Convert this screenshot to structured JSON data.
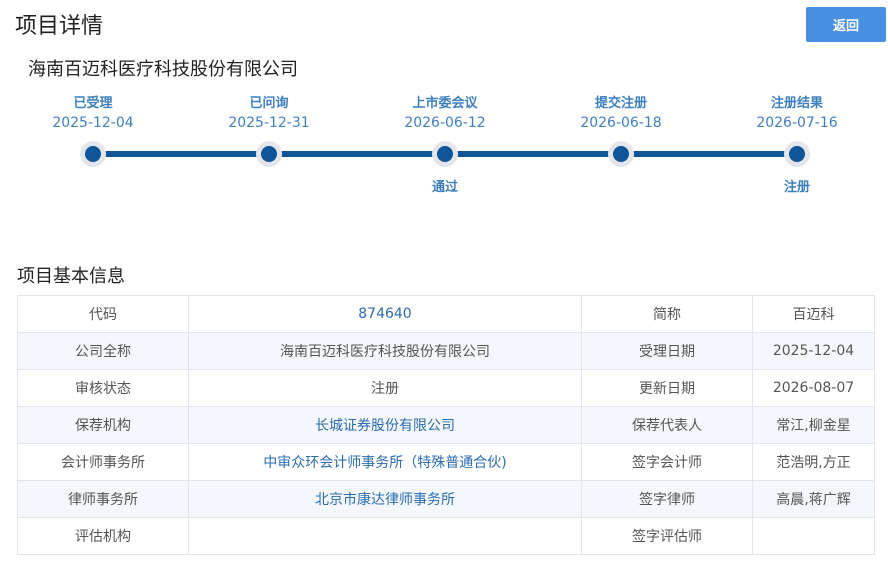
{
  "header": {
    "title": "项目详情",
    "back_label": "返回"
  },
  "company_name": "海南百迈科医疗科技股份有限公司",
  "timeline": {
    "steps": [
      {
        "label": "已受理",
        "date": "2025-12-04",
        "result": ""
      },
      {
        "label": "已问询",
        "date": "2025-12-31",
        "result": ""
      },
      {
        "label": "上市委会议",
        "date": "2026-06-12",
        "result": "通过"
      },
      {
        "label": "提交注册",
        "date": "2026-06-18",
        "result": ""
      },
      {
        "label": "注册结果",
        "date": "2026-07-16",
        "result": "注册"
      }
    ]
  },
  "basic_info": {
    "title": "项目基本信息",
    "rows": [
      {
        "k1": "代码",
        "v1": "874640",
        "k2": "简称",
        "v2": "百迈科"
      },
      {
        "k1": "公司全称",
        "v1": "海南百迈科医疗科技股份有限公司",
        "k2": "受理日期",
        "v2": "2025-12-04"
      },
      {
        "k1": "审核状态",
        "v1": "注册",
        "k2": "更新日期",
        "v2": "2026-08-07"
      },
      {
        "k1": "保荐机构",
        "v1": "长城证券股份有限公司",
        "k2": "保荐代表人",
        "v2": "常江,柳金星"
      },
      {
        "k1": "会计师事务所",
        "v1": "中审众环会计师事务所（特殊普通合伙)",
        "k2": "签字会计师",
        "v2": "范浩明,方正"
      },
      {
        "k1": "律师事务所",
        "v1": "北京市康达律师事务所",
        "k2": "签字律师",
        "v2": "高晨,蒋广辉"
      },
      {
        "k1": "评估机构",
        "v1": "",
        "k2": "签字评估师",
        "v2": ""
      }
    ]
  },
  "colors": {
    "accent": "#4a90e2",
    "timeline_line": "#0f5599",
    "link_text": "#2b6cb0",
    "label_text": "#3d7fc1"
  }
}
